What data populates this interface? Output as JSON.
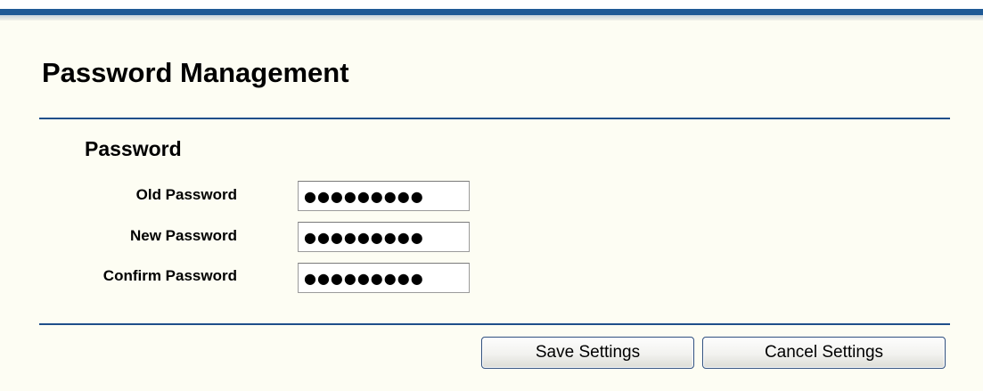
{
  "page": {
    "title": "Password Management"
  },
  "section": {
    "title": "Password"
  },
  "fields": [
    {
      "label": "Old Password",
      "value": "●●●●●●●●●"
    },
    {
      "label": "New Password",
      "value": "●●●●●●●●●"
    },
    {
      "label": "Confirm Password",
      "value": "●●●●●●●●●"
    }
  ],
  "buttons": {
    "save_label": "Save Settings",
    "cancel_label": "Cancel Settings"
  },
  "colors": {
    "accent": "#1f5a96",
    "panel_background": "#fdfdf3",
    "rule": "#1f4f8a"
  }
}
